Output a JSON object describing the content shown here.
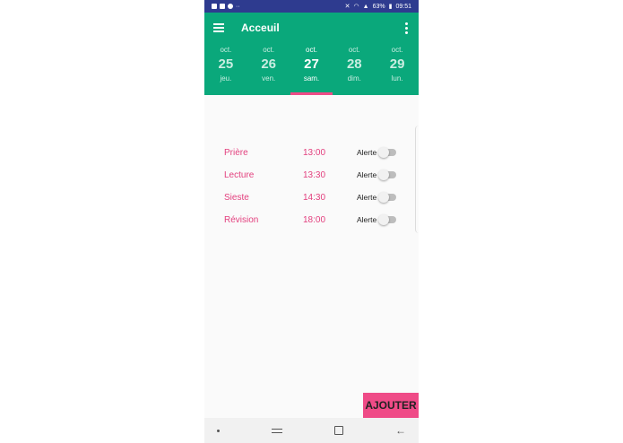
{
  "status_bar": {
    "battery": "63%",
    "time": "09:51"
  },
  "toolbar": {
    "title": "Acceuil"
  },
  "days": [
    {
      "month": "oct.",
      "day": "25",
      "weekday": "jeu."
    },
    {
      "month": "oct.",
      "day": "26",
      "weekday": "ven."
    },
    {
      "month": "oct.",
      "day": "27",
      "weekday": "sam."
    },
    {
      "month": "oct.",
      "day": "28",
      "weekday": "dim."
    },
    {
      "month": "oct.",
      "day": "29",
      "weekday": "lun."
    }
  ],
  "selected_day_index": 2,
  "schedule": [
    {
      "label": "Prière",
      "time": "13:00",
      "alert_label": "Alerte",
      "alert_on": false
    },
    {
      "label": "Lecture",
      "time": "13:30",
      "alert_label": "Alerte",
      "alert_on": false
    },
    {
      "label": "Sieste",
      "time": "14:30",
      "alert_label": "Alerte",
      "alert_on": false
    },
    {
      "label": "Révision",
      "time": "18:00",
      "alert_label": "Alerte",
      "alert_on": false
    }
  ],
  "add_button_label": "AJOUTER",
  "colors": {
    "status_bar": "#2e3b8f",
    "primary": "#0aa87b",
    "accent": "#ef4b87",
    "item_text": "#e3407e"
  },
  "icons": {
    "menu": "hamburger-menu-icon",
    "overflow": "vertical-dots-icon",
    "nav_recent": "recent-apps-icon",
    "nav_home": "home-square-icon",
    "nav_back": "back-arrow-icon"
  }
}
